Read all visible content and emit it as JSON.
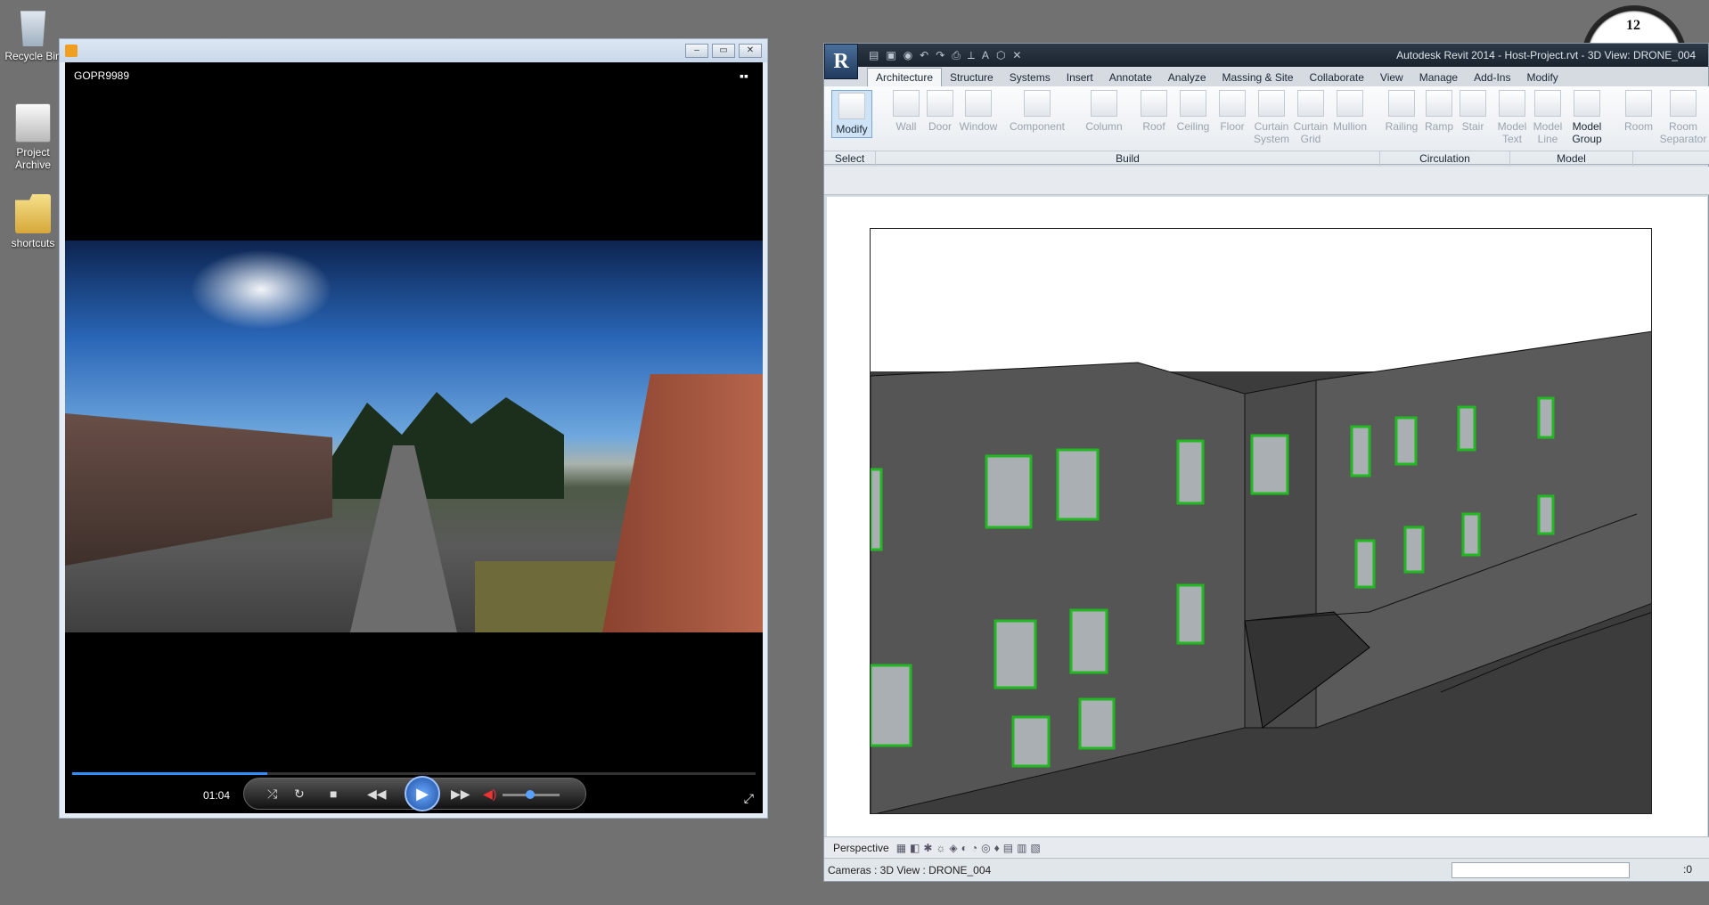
{
  "desktop": {
    "icons": [
      {
        "label": "Recycle Bin"
      },
      {
        "label": "Project Archive"
      },
      {
        "label": "shortcuts"
      }
    ],
    "clock_number": "12"
  },
  "media_player": {
    "file_name": "GOPR9989",
    "time": "01:04",
    "progress": 0.285,
    "volume": 0.4,
    "controls": [
      "shuffle",
      "repeat",
      "stop",
      "previous",
      "play",
      "next",
      "mute",
      "volume"
    ]
  },
  "revit": {
    "caption": "Autodesk Revit 2014 -    Host-Project.rvt - 3D View: DRONE_004",
    "app_letter": "R",
    "tabs": [
      "Architecture",
      "Structure",
      "Systems",
      "Insert",
      "Annotate",
      "Analyze",
      "Massing & Site",
      "Collaborate",
      "View",
      "Manage",
      "Add-Ins",
      "Modify"
    ],
    "active_tab": "Architecture",
    "tools": [
      "Modify",
      "Wall",
      "Door",
      "Window",
      "Component",
      "Column",
      "Roof",
      "Ceiling",
      "Floor",
      "Curtain System",
      "Curtain Grid",
      "Mullion",
      "Railing",
      "Ramp",
      "Stair",
      "Model Text",
      "Model Line",
      "Model Group",
      "Room",
      "Room Separator"
    ],
    "groups": [
      "Select",
      "Build",
      "Circulation",
      "Model"
    ],
    "view_mode": "Perspective",
    "status_text": "Cameras : 3D View : DRONE_004",
    "status_right": ":0"
  }
}
